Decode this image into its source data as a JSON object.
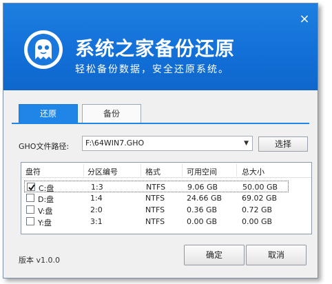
{
  "header": {
    "title": "系统之家备份还原",
    "subtitle": "轻松备份数据，安全还原系统。",
    "close_icon": "×"
  },
  "tabs": [
    {
      "label": "还原",
      "active": true
    },
    {
      "label": "备份",
      "active": false
    }
  ],
  "path": {
    "label": "GHO文件路径:",
    "value": "F:\\64WIN7.GHO",
    "browse_label": "选择"
  },
  "table": {
    "columns": [
      "盘符",
      "分区编号",
      "格式",
      "可用空间",
      "总大小"
    ],
    "rows": [
      {
        "drive": "C:盘",
        "partition": "1:3",
        "format": "NTFS",
        "free": "9.06 GB",
        "total": "50.00 GB",
        "checked": true
      },
      {
        "drive": "D:盘",
        "partition": "1:4",
        "format": "NTFS",
        "free": "24.66 GB",
        "total": "69.02 GB",
        "checked": false
      },
      {
        "drive": "V:盘",
        "partition": "2:0",
        "format": "NTFS",
        "free": "0.36 GB",
        "total": "0.72 GB",
        "checked": false
      },
      {
        "drive": "Y:盘",
        "partition": "3:1",
        "format": "NTFS",
        "free": "0.00 GB",
        "total": "0.00 GB",
        "checked": false
      }
    ]
  },
  "footer": {
    "version": "版本 v1.0.0",
    "ok_label": "确定",
    "cancel_label": "取消"
  },
  "colors": {
    "header_blue": "#1270d8",
    "tab_active": "#1f86e8"
  }
}
